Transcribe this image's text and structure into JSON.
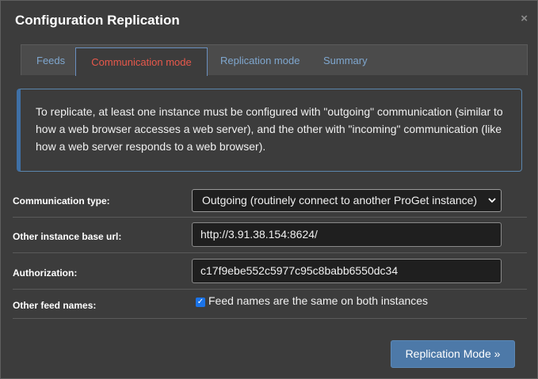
{
  "dialog": {
    "title": "Configuration Replication",
    "close_glyph": "×"
  },
  "tabs": [
    {
      "label": "Feeds",
      "active": false
    },
    {
      "label": "Communication mode",
      "active": true
    },
    {
      "label": "Replication mode",
      "active": false
    },
    {
      "label": "Summary",
      "active": false
    }
  ],
  "info_text": "To replicate, at least one instance must be configured with \"outgoing\" communication (similar to how a web browser accesses a web server), and the other with \"incoming\" communication (like how a web server responds to a web browser).",
  "form": {
    "communication_type": {
      "label": "Communication type:",
      "value": "Outgoing (routinely connect to another ProGet instance)"
    },
    "base_url": {
      "label": "Other instance base url:",
      "value": "http://3.91.38.154:8624/"
    },
    "authorization": {
      "label": "Authorization:",
      "value": "c17f9ebe552c5977c95c8babb6550dc34"
    },
    "feed_names": {
      "label": "Other feed names:",
      "checkbox_label": "Feed names are the same on both instances",
      "checked": true
    }
  },
  "actions": {
    "next_label": "Replication Mode »"
  },
  "colors": {
    "accent": "#4d79a8",
    "active_tab": "#e8584b",
    "tab_link": "#7fa7cf"
  },
  "icons": {
    "close": "close-icon",
    "dropdown": "chevron-down-icon",
    "check": "checkmark-icon"
  }
}
